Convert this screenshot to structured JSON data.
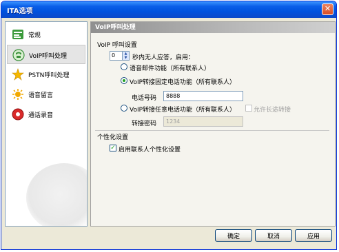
{
  "window": {
    "title": "ITA选项",
    "close_symbol": "✕"
  },
  "sidebar": {
    "items": [
      {
        "label": "常规",
        "icon": "settings-icon"
      },
      {
        "label": "VoIP呼叫处理",
        "icon": "voip-call-icon"
      },
      {
        "label": "PSTN呼叫处理",
        "icon": "pstn-call-icon"
      },
      {
        "label": "语音留言",
        "icon": "voicemail-icon"
      },
      {
        "label": "通话录音",
        "icon": "record-icon"
      }
    ],
    "selected_index": 1
  },
  "panel": {
    "header": "VoIP呼叫处理",
    "voip_section": "VoIP 呼叫设置",
    "rings_value": "0",
    "rings_text": "秒内无人应答，启用：",
    "option_voicemail": "语音邮件功能（所有联系人）",
    "option_fixed": "VoIP转接固定电话功能（所有联系人）",
    "phone_label": "电话号码",
    "phone_value": "8888",
    "option_any": "VoIP转接任意电话功能（所有联系人）",
    "allow_long_distance": "允许长途转接",
    "transfer_pwd_label": "转接密码",
    "transfer_pwd_value": "1234",
    "personal_section": "个性化设置",
    "enable_personal": "启用联系人个性化设置",
    "selected_option": "fixed"
  },
  "buttons": {
    "ok": "确定",
    "cancel": "取消",
    "apply": "应用"
  },
  "colors": {
    "titlebar": "#0a5fe8",
    "window_bg": "#ece9d8",
    "header_bg": "#9a9a9a"
  }
}
